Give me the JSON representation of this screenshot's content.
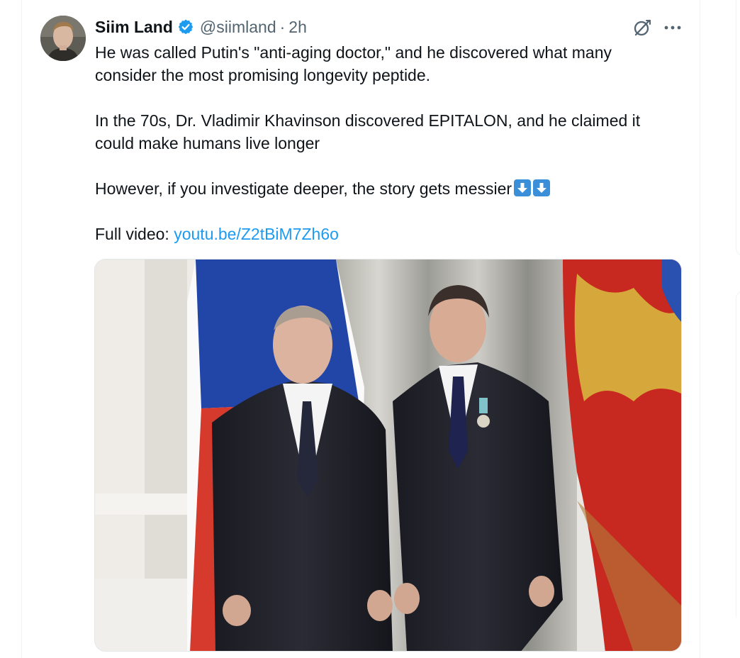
{
  "author": {
    "display_name": "Siim Land",
    "handle": "@siimland",
    "separator": "·",
    "time": "2h"
  },
  "tweet": {
    "line1": "He was called Putin's \"anti-aging doctor,\" and he discovered what many",
    "line2": "consider the most promising longevity peptide.",
    "line3": "In the 70s, Dr. Vladimir Khavinson discovered EPITALON, and he claimed it",
    "line4": "could make humans live longer",
    "line5": "However, if you investigate deeper, the story gets messier",
    "video_label": "Full video: ",
    "video_link": "youtu.be/Z2tBiM7Zh6o"
  },
  "icons": {
    "verified": "verified-badge-icon",
    "grok": "grok-icon",
    "more": "more-icon",
    "emoji": "down-arrow-emoji-icon"
  },
  "colors": {
    "link": "#1d9bf0",
    "verified": "#1d9bf0",
    "secondary_text": "#536471"
  }
}
